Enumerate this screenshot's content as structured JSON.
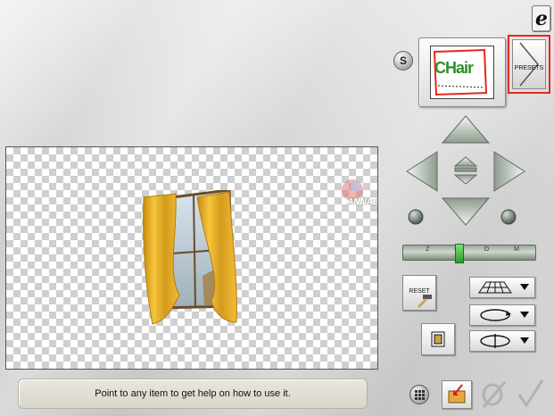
{
  "header": {
    "logo_icon": "swirl-logo-icon",
    "s_button_label": "S"
  },
  "preset": {
    "thumbnail_text": "CHair",
    "presets_button_label": "PRESETS",
    "highlight_color": "#e8261c"
  },
  "navigation": {
    "up_icon": "arrow-up-icon",
    "down_icon": "arrow-down-icon",
    "left_icon": "arrow-left-icon",
    "right_icon": "arrow-right-icon",
    "center_up_icon": "nudge-up-icon",
    "center_down_icon": "nudge-down-icon",
    "rotate_left_icon": "rotate-left-icon",
    "rotate_right_icon": "rotate-right-icon"
  },
  "zoom": {
    "track_label": "Z O O M",
    "level": 0.42
  },
  "tools": {
    "reset_label": "RESET",
    "perspective_icon": "perspective-grid-icon",
    "rotate_icon": "rotate-ellipse-icon",
    "flip_icon": "flip-horizontal-icon",
    "frame_icon": "frame-icon"
  },
  "canvas": {
    "watermark_text": "ANNABELLE"
  },
  "status": {
    "help_text": "Point to any item to get help on how to use it."
  },
  "footer": {
    "grid_icon": "grid-toggle-icon",
    "open_icon": "open-folder-icon",
    "cancel_icon": "cancel-icon",
    "ok_icon": "checkmark-icon"
  }
}
